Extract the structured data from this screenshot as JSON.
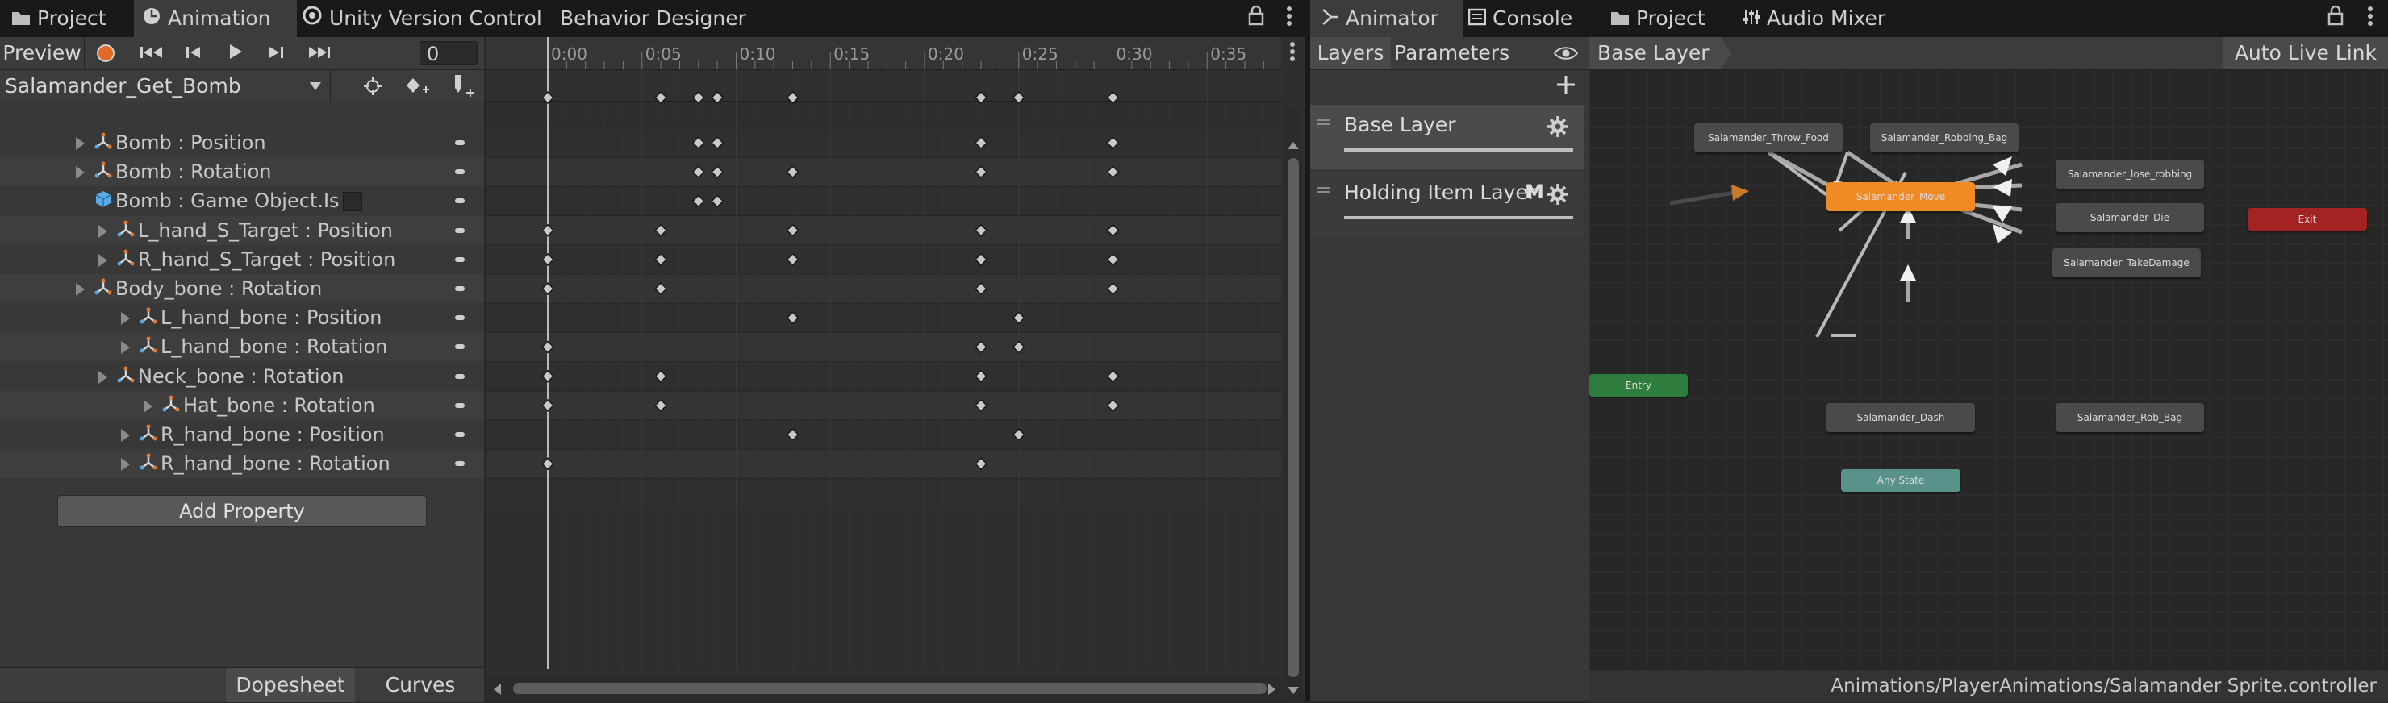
{
  "left_tabs": [
    {
      "label": "Project",
      "icon": "folder-icon"
    },
    {
      "label": "Animation",
      "icon": "clock-icon"
    },
    {
      "label": "Unity Version Control",
      "icon": "version-control-icon"
    },
    {
      "label": "Behavior Designer",
      "icon": ""
    }
  ],
  "right_tabs": [
    {
      "label": "Animator",
      "icon": "animator-icon"
    },
    {
      "label": "Console",
      "icon": "console-icon"
    },
    {
      "label": "Project",
      "icon": "folder-icon"
    },
    {
      "label": "Audio Mixer",
      "icon": "mixer-icon"
    }
  ],
  "animation": {
    "preview_label": "Preview",
    "frame_value": "0",
    "clip_name": "Salamander_Get_Bomb",
    "add_property_label": "Add Property",
    "bottom_tabs": [
      "Dopesheet",
      "Curves"
    ],
    "ruler_labels": [
      "0:00",
      "0:05",
      "0:10",
      "0:15",
      "0:20",
      "0:25",
      "0:30",
      "0:35"
    ],
    "properties": [
      {
        "label": "Bomb : Position",
        "indent": 0,
        "icon": "transform-icon"
      },
      {
        "label": "Bomb : Rotation",
        "indent": 0,
        "icon": "transform-icon"
      },
      {
        "label": "Bomb : Game Object.Is",
        "indent": 0,
        "icon": "gameobject-icon"
      },
      {
        "label": "L_hand_S_Target : Position",
        "indent": 1,
        "icon": "transform-icon"
      },
      {
        "label": "R_hand_S_Target : Position",
        "indent": 1,
        "icon": "transform-icon"
      },
      {
        "label": "Body_bone : Rotation",
        "indent": 0,
        "icon": "transform-icon"
      },
      {
        "label": "L_hand_bone : Position",
        "indent": 2,
        "icon": "transform-icon"
      },
      {
        "label": "L_hand_bone : Rotation",
        "indent": 2,
        "icon": "transform-icon"
      },
      {
        "label": "Neck_bone : Rotation",
        "indent": 1,
        "icon": "transform-icon"
      },
      {
        "label": "Hat_bone : Rotation",
        "indent": 3,
        "icon": "transform-icon"
      },
      {
        "label": "R_hand_bone : Position",
        "indent": 2,
        "icon": "transform-icon"
      },
      {
        "label": "R_hand_bone : Rotation",
        "indent": 2,
        "icon": "transform-icon"
      }
    ],
    "keyframes": {
      "summary": [
        0,
        6,
        8,
        9,
        13,
        23,
        25,
        30
      ],
      "rows": [
        [
          8,
          9,
          23,
          30
        ],
        [
          8,
          9,
          13,
          23,
          30
        ],
        [
          8,
          9
        ],
        [
          0,
          6,
          13,
          23,
          30
        ],
        [
          0,
          6,
          13,
          23,
          30
        ],
        [
          0,
          6,
          23,
          30
        ],
        [
          13,
          25
        ],
        [
          0,
          23,
          25
        ],
        [
          0,
          6,
          23,
          30
        ],
        [
          0,
          6,
          23,
          30
        ],
        [
          13,
          25
        ],
        [
          0,
          23
        ]
      ]
    }
  },
  "animator": {
    "subtabs": [
      "Layers",
      "Parameters"
    ],
    "breadcrumb": "Base Layer",
    "auto_live_link": "Auto Live Link",
    "layers": [
      {
        "name": "Base Layer",
        "badge": ""
      },
      {
        "name": "Holding Item Layer",
        "badge": "M"
      }
    ],
    "states": {
      "move": "Salamander_Move",
      "throw_food": "Salamander_Throw_Food",
      "robbing_bag": "Salamander_Robbing_Bag",
      "lose_robbing": "Salamander_lose_robbing",
      "die": "Salamander_Die",
      "take_damage": "Salamander_TakeDamage",
      "rob_bag": "Salamander_Rob_Bag",
      "dash": "Salamander_Dash",
      "any_state": "Any State",
      "entry": "Entry",
      "exit": "Exit"
    },
    "status_path": "Animations/PlayerAnimations/Salamander Sprite.controller"
  },
  "colors": {
    "default_state": "#f08a24",
    "entry": "#2f7d3c",
    "exit": "#a32222",
    "any_state": "#58928b",
    "record": "#e06a2a"
  }
}
